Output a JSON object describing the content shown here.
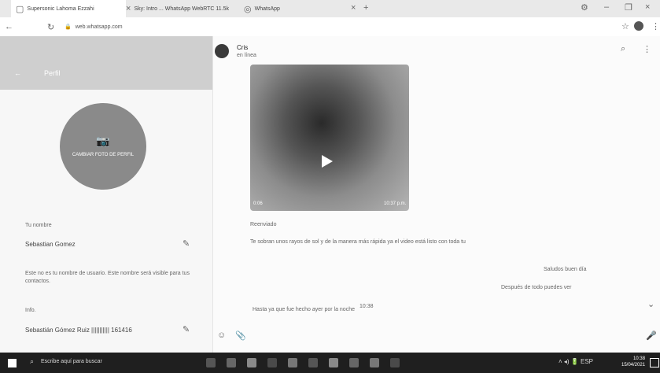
{
  "browser": {
    "tabs": [
      {
        "label": "Supersonic Lahoma Ezzahi"
      },
      {
        "label": "Sky: Intro ... WhatsApp WebRTC 11.5k"
      },
      {
        "label": "WhatsApp"
      }
    ],
    "url": "web.whatsapp.com"
  },
  "left": {
    "header_title": "Perfil",
    "avatar_caption": "CAMBIAR FOTO DE PERFIL",
    "name_label": "Tu nombre",
    "name_value": "Sebastian Gomez",
    "name_note": "Este no es tu nombre de usuario. Este nombre será visible para tus contactos.",
    "info_label": "Info.",
    "info_value": "Sebastián Gómez Ruiz ||||||||||| 161416"
  },
  "chat": {
    "contact_name": "Cris",
    "contact_status": "en línea",
    "video_duration": "0:06",
    "video_time": "10:37 p.m.",
    "forward_text": "Reenviado",
    "message_1": "Te sobran unos rayos de sol y de la manera más rápida ya el video está listo con toda tu",
    "message_2": "Saludos buen día",
    "message_2_sub": "Después de todo puedes ver",
    "message_3": "Hasta ya que fue hecho ayer por la noche",
    "message_3_time": "10:38"
  },
  "taskbar": {
    "search_placeholder": "Escribe aquí para buscar",
    "time": "10:38",
    "date": "15/04/2021"
  }
}
